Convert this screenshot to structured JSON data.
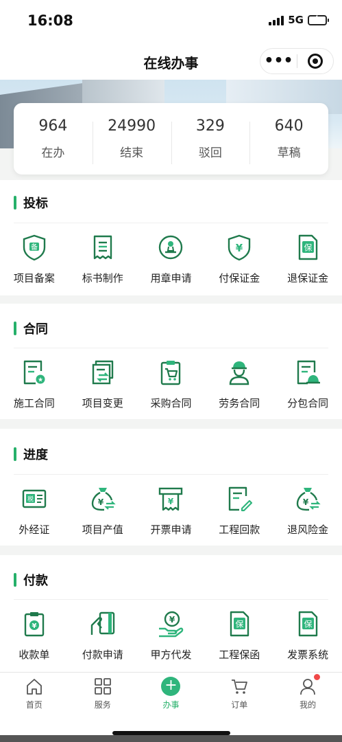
{
  "status": {
    "time": "16:08",
    "network": "5G"
  },
  "nav": {
    "title": "在线办事",
    "more": "•••"
  },
  "stats": [
    {
      "value": "964",
      "label": "在办"
    },
    {
      "value": "24990",
      "label": "结束"
    },
    {
      "value": "329",
      "label": "驳回"
    },
    {
      "value": "640",
      "label": "草稿"
    }
  ],
  "sections": [
    {
      "title": "投标",
      "items": [
        {
          "label": "项目备案",
          "icon": "shield-bei-icon"
        },
        {
          "label": "标书制作",
          "icon": "document-lines-icon"
        },
        {
          "label": "用章申请",
          "icon": "stamp-icon"
        },
        {
          "label": "付保证金",
          "icon": "shield-yen-icon"
        },
        {
          "label": "退保证金",
          "icon": "doc-bao-icon"
        }
      ]
    },
    {
      "title": "合同",
      "items": [
        {
          "label": "施工合同",
          "icon": "contract-icon"
        },
        {
          "label": "项目变更",
          "icon": "change-icon"
        },
        {
          "label": "采购合同",
          "icon": "cart-clipboard-icon"
        },
        {
          "label": "劳务合同",
          "icon": "worker-icon"
        },
        {
          "label": "分包合同",
          "icon": "doc-helmet-icon"
        }
      ]
    },
    {
      "title": "进度",
      "items": [
        {
          "label": "外经证",
          "icon": "tax-card-icon"
        },
        {
          "label": "项目产值",
          "icon": "money-bag-icon"
        },
        {
          "label": "开票申请",
          "icon": "invoice-print-icon"
        },
        {
          "label": "工程回款",
          "icon": "doc-pen-icon"
        },
        {
          "label": "退风险金",
          "icon": "money-bag-refund-icon"
        }
      ]
    },
    {
      "title": "付款",
      "items": [
        {
          "label": "收款单",
          "icon": "receipt-yen-icon"
        },
        {
          "label": "付款申请",
          "icon": "card-hand-icon"
        },
        {
          "label": "甲方代发",
          "icon": "hand-yen-icon"
        },
        {
          "label": "工程保函",
          "icon": "doc-bao-icon"
        },
        {
          "label": "发票系统",
          "icon": "doc-bao-icon"
        }
      ]
    }
  ],
  "tabs": [
    {
      "label": "首页",
      "icon": "home-icon"
    },
    {
      "label": "服务",
      "icon": "grid-icon"
    },
    {
      "label": "办事",
      "icon": "plus-icon"
    },
    {
      "label": "订单",
      "icon": "cart-icon"
    },
    {
      "label": "我的",
      "icon": "user-icon"
    }
  ],
  "colors": {
    "accent": "#26b06a",
    "icon": "#1f7a4c",
    "badge": "#f04848"
  }
}
